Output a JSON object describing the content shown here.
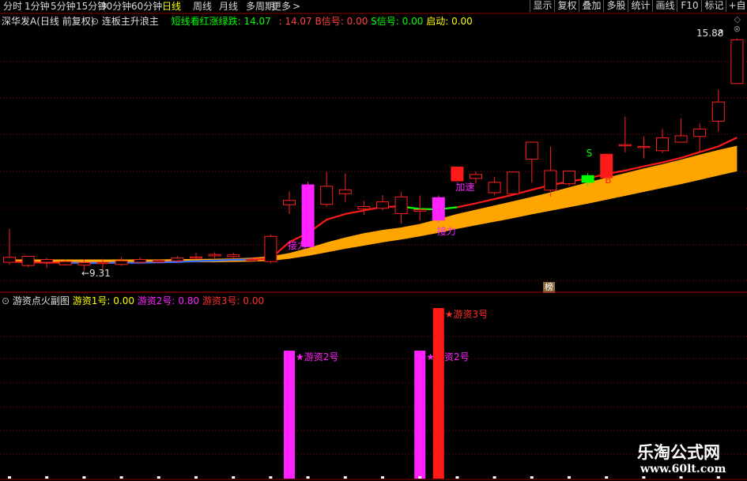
{
  "timeframes": [
    "分时",
    "1分钟",
    "5分钟",
    "15分钟",
    "30分钟",
    "60分钟",
    "日线",
    "周线",
    "月线",
    "多周期",
    "更多"
  ],
  "active_timeframe": "日线",
  "toolbar": [
    "显示",
    "复权",
    "叠加",
    "多股",
    "统计",
    "画线",
    "F10",
    "标记",
    "+自"
  ],
  "main_header": {
    "stock": "深华发A",
    "mode": "(日线 前复权)",
    "indicator": "连板主升浪主",
    "green_label": "短线看红涨绿跌:",
    "green_value": "14.07",
    "red_value": "14.07",
    "b_label": "B信号:",
    "b_value": "0.00",
    "s_label": "S信号:",
    "s_value": "0.00",
    "start_label": "启动:",
    "start_value": "0.00"
  },
  "sub_header": {
    "title": "游资点火副图",
    "s1_label": "游资1号:",
    "s1_value": "0.00",
    "s2_label": "游资2号:",
    "s2_value": "0.80",
    "s3_label": "游资3号:",
    "s3_value": "0.00"
  },
  "high_label": "15.88",
  "low_label": "9.31",
  "bang_label": "榜",
  "watermark_title": "乐淘公式网",
  "watermark_url": "www.60lt.com",
  "colors": {
    "up": "#ff2020",
    "down": "#00e5ff",
    "magenta": "#ff22ff",
    "green_signal": "#00ff00",
    "band": "#ffa500",
    "ma": "#ff1a1a",
    "grid": "#8b0000"
  },
  "chart_data": {
    "type": "candlestick",
    "y_range_price": [
      9.0,
      16.2
    ],
    "candles": [
      {
        "o": 9.76,
        "h": 10.56,
        "l": 9.55,
        "c": 9.62,
        "k": "bear"
      },
      {
        "o": 9.53,
        "h": 9.78,
        "l": 9.48,
        "c": 9.79,
        "k": "bull"
      },
      {
        "o": 9.7,
        "h": 9.74,
        "l": 9.46,
        "c": 9.62,
        "k": "bear"
      },
      {
        "o": 9.55,
        "h": 9.68,
        "l": 9.53,
        "c": 9.64,
        "k": "bull"
      },
      {
        "o": 9.61,
        "h": 9.7,
        "l": 9.38,
        "c": 9.54,
        "k": "bear"
      },
      {
        "o": 9.59,
        "h": 9.72,
        "l": 9.42,
        "c": 9.62,
        "k": "bull"
      },
      {
        "o": 9.66,
        "h": 9.76,
        "l": 9.52,
        "c": 9.56,
        "k": "bear"
      },
      {
        "o": 9.62,
        "h": 9.76,
        "l": 9.59,
        "c": 9.7,
        "k": "bull"
      },
      {
        "o": 9.67,
        "h": 9.71,
        "l": 9.6,
        "c": 9.63,
        "k": "bear"
      },
      {
        "o": 9.66,
        "h": 9.8,
        "l": 9.62,
        "c": 9.74,
        "k": "bull"
      },
      {
        "o": 9.75,
        "h": 9.89,
        "l": 9.7,
        "c": 9.77,
        "k": "bull"
      },
      {
        "o": 9.84,
        "h": 9.9,
        "l": 9.73,
        "c": 9.8,
        "k": "bull"
      },
      {
        "o": 9.78,
        "h": 9.89,
        "l": 9.74,
        "c": 9.83,
        "k": "bull"
      },
      {
        "o": 9.69,
        "h": 9.76,
        "l": 9.64,
        "c": 9.7,
        "k": "bull"
      },
      {
        "o": 9.64,
        "h": 10.4,
        "l": 9.59,
        "c": 10.35,
        "k": "bull"
      },
      {
        "o": 11.24,
        "h": 11.61,
        "l": 10.98,
        "c": 11.36,
        "k": "bull"
      },
      {
        "o": 10.06,
        "h": 11.89,
        "l": 10.06,
        "c": 11.8,
        "k": "mag"
      },
      {
        "o": 11.25,
        "h": 12.17,
        "l": 11.18,
        "c": 11.76,
        "k": "bull"
      },
      {
        "o": 11.55,
        "h": 12.12,
        "l": 11.32,
        "c": 11.66,
        "k": "bull"
      },
      {
        "o": 11.12,
        "h": 11.35,
        "l": 10.95,
        "c": 11.19,
        "k": "bull"
      },
      {
        "o": 11.14,
        "h": 11.51,
        "l": 11.08,
        "c": 11.32,
        "k": "bull"
      },
      {
        "o": 10.99,
        "h": 11.6,
        "l": 10.71,
        "c": 11.46,
        "k": "bull"
      },
      {
        "o": 11.06,
        "h": 11.5,
        "l": 10.8,
        "c": 11.1,
        "k": "bull"
      },
      {
        "o": 10.81,
        "h": 11.5,
        "l": 10.73,
        "c": 11.44,
        "k": "mag"
      },
      {
        "o": 12.3,
        "h": 12.3,
        "l": 11.91,
        "c": 11.91,
        "k": "redfill"
      },
      {
        "o": 11.98,
        "h": 12.18,
        "l": 11.83,
        "c": 12.09,
        "k": "bull"
      },
      {
        "o": 11.58,
        "h": 12.02,
        "l": 11.51,
        "c": 11.87,
        "k": "bull"
      },
      {
        "o": 11.55,
        "h": 12.17,
        "l": 11.55,
        "c": 12.16,
        "k": "bull"
      },
      {
        "o": 12.52,
        "h": 12.93,
        "l": 11.86,
        "c": 13.0,
        "k": "bull"
      },
      {
        "o": 11.65,
        "h": 12.88,
        "l": 11.47,
        "c": 12.2,
        "k": "black"
      },
      {
        "o": 11.83,
        "h": 12.18,
        "l": 11.76,
        "c": 12.19,
        "k": "bull"
      },
      {
        "o": 12.06,
        "h": 12.13,
        "l": 11.75,
        "c": 11.87,
        "k": "green"
      },
      {
        "o": 12.66,
        "h": 12.66,
        "l": 12.0,
        "c": 12.0,
        "k": "redfill"
      },
      {
        "o": 12.93,
        "h": 13.72,
        "l": 12.71,
        "c": 12.93,
        "k": "bull"
      },
      {
        "o": 12.87,
        "h": 13.16,
        "l": 12.54,
        "c": 12.88,
        "k": "bull"
      },
      {
        "o": 12.76,
        "h": 13.37,
        "l": 12.69,
        "c": 13.12,
        "k": "bull"
      },
      {
        "o": 13.0,
        "h": 13.67,
        "l": 12.98,
        "c": 13.18,
        "k": "bull"
      },
      {
        "o": 13.16,
        "h": 13.52,
        "l": 12.74,
        "c": 13.37,
        "k": "bull"
      },
      {
        "o": 13.59,
        "h": 14.48,
        "l": 13.3,
        "c": 14.13,
        "k": "bull"
      },
      {
        "o": 14.65,
        "h": 15.92,
        "l": 14.65,
        "c": 15.88,
        "k": "bull"
      }
    ],
    "ma": [
      9.64,
      9.62,
      9.61,
      9.61,
      9.6,
      9.6,
      9.61,
      9.61,
      9.62,
      9.63,
      9.65,
      9.67,
      9.69,
      9.7,
      9.72,
      10.19,
      10.44,
      10.82,
      10.98,
      11.08,
      11.18,
      11.19,
      11.12,
      11.11,
      11.17,
      11.28,
      11.4,
      11.52,
      11.66,
      11.79,
      11.89,
      11.98,
      12.11,
      12.2,
      12.32,
      12.43,
      12.56,
      12.72,
      12.88,
      13.13
    ],
    "ma_green_segments": [
      [
        3,
        13
      ],
      [
        21,
        24
      ]
    ],
    "band_top": [
      9.7,
      9.7,
      9.7,
      9.7,
      9.7,
      9.7,
      9.7,
      9.7,
      9.7,
      9.71,
      9.71,
      9.72,
      9.73,
      9.75,
      9.79,
      9.88,
      10.02,
      10.18,
      10.32,
      10.44,
      10.53,
      10.6,
      10.7,
      10.84,
      10.98,
      11.1,
      11.22,
      11.34,
      11.46,
      11.59,
      11.73,
      11.87,
      12.0,
      12.13,
      12.26,
      12.38,
      12.51,
      12.65,
      12.78,
      12.9
    ],
    "band_bottom": [
      9.62,
      9.62,
      9.62,
      9.62,
      9.62,
      9.62,
      9.62,
      9.62,
      9.62,
      9.62,
      9.62,
      9.62,
      9.63,
      9.64,
      9.66,
      9.72,
      9.8,
      9.9,
      10.0,
      10.09,
      10.18,
      10.26,
      10.35,
      10.45,
      10.56,
      10.66,
      10.76,
      10.86,
      10.97,
      11.07,
      11.17,
      11.27,
      11.38,
      11.49,
      11.6,
      11.71,
      11.82,
      11.94,
      12.06,
      12.18
    ],
    "labels": [
      {
        "i": 15,
        "text": "接力",
        "price": 10.0
      },
      {
        "i": 23,
        "text": "接力",
        "price": 10.4
      },
      {
        "i": 24,
        "text": "加速",
        "price": 11.65
      },
      {
        "i": 31,
        "text": "S",
        "price": 12.6
      },
      {
        "i": 32,
        "text": "B",
        "price": 11.85
      }
    ],
    "sub_y_range": [
      0,
      2.0
    ],
    "sub_bars": [
      {
        "i": 15,
        "value": 1.5,
        "color": "magenta",
        "label": "游资2号"
      },
      {
        "i": 22,
        "value": 1.5,
        "color": "magenta",
        "label": "游资2号"
      },
      {
        "i": 23,
        "value": 2.0,
        "color": "red",
        "label": "游资3号"
      }
    ]
  }
}
